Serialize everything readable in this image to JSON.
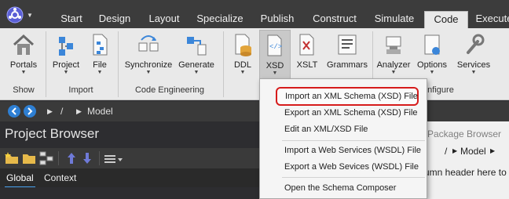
{
  "menubar": {
    "tabs": [
      {
        "label": "Start"
      },
      {
        "label": "Design"
      },
      {
        "label": "Layout"
      },
      {
        "label": "Specialize"
      },
      {
        "label": "Publish"
      },
      {
        "label": "Construct"
      },
      {
        "label": "Simulate"
      },
      {
        "label": "Code",
        "active": true
      },
      {
        "label": "Execute"
      }
    ],
    "app_icon": "app-logo-icon"
  },
  "ribbon": {
    "buttons": {
      "portals": "Portals",
      "project": "Project",
      "file": "File",
      "synchronize": "Synchronize",
      "generate": "Generate",
      "ddl": "DDL",
      "xsd": "XSD",
      "xslt": "XSLT",
      "grammars": "Grammars",
      "analyzer": "Analyzer",
      "options": "Options",
      "services": "Services"
    },
    "groups": {
      "show": "Show",
      "import": "Import",
      "code_engineering": "Code Engineering",
      "configure": "nfigure"
    }
  },
  "breadcrumb": {
    "root": "/",
    "model": "Model"
  },
  "project_browser": {
    "title": "Project Browser",
    "tabs": [
      "Global",
      "Context"
    ]
  },
  "package_browser": {
    "title": "Package Browser",
    "root": "/",
    "model": "Model",
    "hint": "umn header here to"
  },
  "xsd_menu": {
    "items": [
      {
        "label": "Import an XML Schema (XSD) File",
        "highlighted": true
      },
      {
        "label": "Export an XML Schema (XSD) File"
      },
      {
        "label": "Edit an XML/XSD File"
      },
      {
        "label": "Import a Web Services (WSDL) File"
      },
      {
        "label": "Export a Web Sevices (WSDL) File"
      },
      {
        "label": "Open the Schema Composer"
      }
    ]
  },
  "colors": {
    "menubar_bg": "#3c3c3c",
    "ribbon_bg": "#e9e9e9",
    "accent_blue": "#2e7fd3",
    "highlight_red": "#d61c1c"
  }
}
